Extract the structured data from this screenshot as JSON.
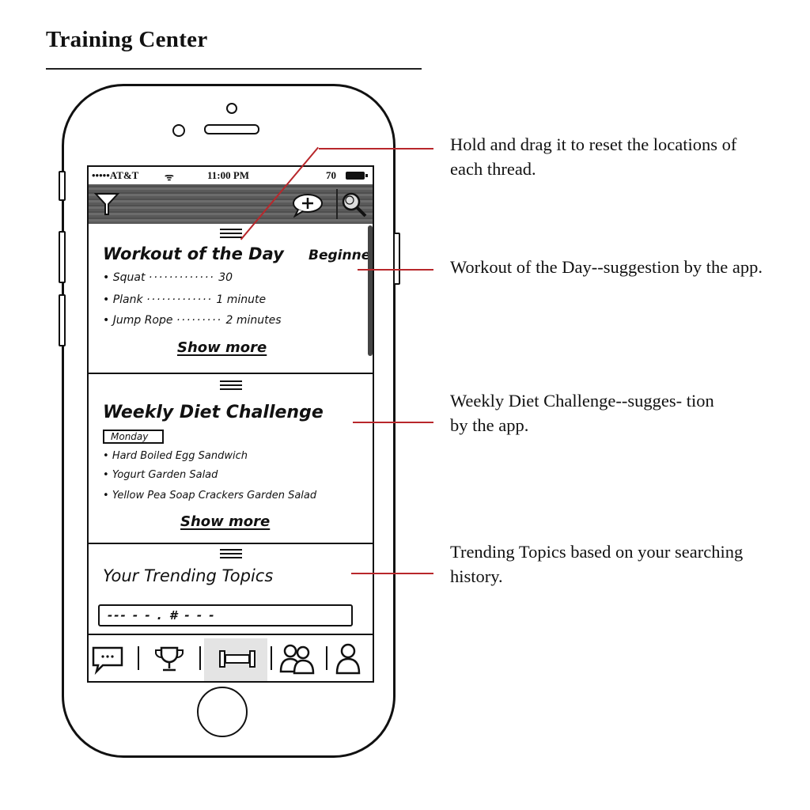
{
  "page": {
    "title": "Training Center"
  },
  "status_bar": {
    "carrier": "•••••AT&T",
    "wifi": "ᯤ",
    "time": "11:00 PM",
    "battery": "70"
  },
  "workout_card": {
    "title": "Workout of the Day",
    "level": "Beginner",
    "items": [
      {
        "name": "Squat",
        "amount": "30"
      },
      {
        "name": "Plank",
        "amount": "1 minute"
      },
      {
        "name": "Jump Rope",
        "amount": "2 minutes"
      }
    ],
    "show_more": "Show more"
  },
  "diet_card": {
    "title": "Weekly Diet Challenge",
    "day": "Monday",
    "items": [
      "Hard Boiled Egg Sandwich",
      "Yogurt Garden Salad",
      "Yellow Pea Soap Crackers Garden Salad"
    ],
    "show_more": "Show more"
  },
  "trending_card": {
    "title": "Your Trending Topics",
    "input_value": "--- - - . # - - -"
  },
  "tab_bar": {
    "icons": [
      "chat-icon",
      "trophy-icon",
      "dumbbell-icon",
      "group-icon",
      "profile-icon"
    ]
  },
  "toolbar": {
    "icons": [
      "filter-icon",
      "add-post-icon",
      "search-icon"
    ]
  },
  "annotations": [
    "Hold and drag it to reset the locations of each thread.",
    "Workout of the Day--suggestion by the app.",
    "Weekly Diet Challenge--sugges- tion by the app.",
    "Trending Topics based on your searching history."
  ],
  "colors": {
    "callout": "#b8272b",
    "toolbar": "#5a5a5a"
  }
}
